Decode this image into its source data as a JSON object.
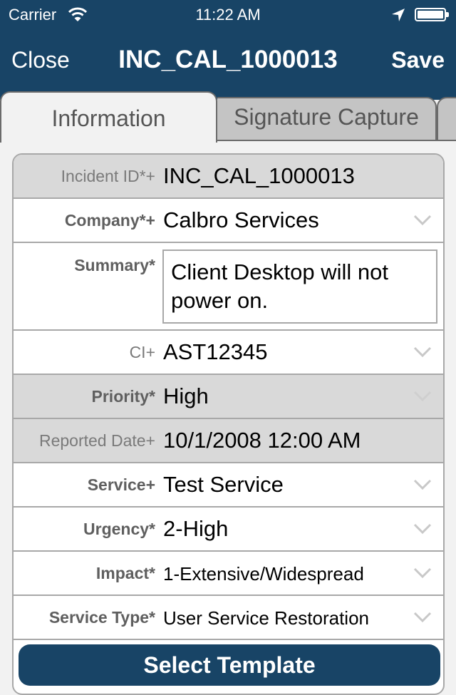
{
  "status_bar": {
    "carrier": "Carrier",
    "time": "11:22 AM",
    "icons": [
      "wifi-icon",
      "location-arrow-icon",
      "battery-icon"
    ]
  },
  "nav": {
    "close_label": "Close",
    "title": "INC_CAL_1000013",
    "save_label": "Save"
  },
  "tabs": [
    {
      "label": "Information",
      "active": true
    },
    {
      "label": "Signature Capture",
      "active": false
    },
    {
      "label": "",
      "active": false
    }
  ],
  "form": {
    "fields": [
      {
        "label": "Incident ID*+",
        "value": "INC_CAL_1000013",
        "readonly": true,
        "dropdown": false
      },
      {
        "label": "Company*+",
        "value": "Calbro Services",
        "readonly": false,
        "dropdown": true
      },
      {
        "label": "Summary*",
        "value": "Client Desktop will not power on.",
        "readonly": false,
        "dropdown": false
      },
      {
        "label": "CI+",
        "value": "AST12345",
        "readonly": false,
        "dropdown": true
      },
      {
        "label": "Priority*",
        "value": "High",
        "readonly": true,
        "dropdown": true
      },
      {
        "label": "Reported Date+",
        "value": "10/1/2008 12:00 AM",
        "readonly": true,
        "dropdown": false
      },
      {
        "label": "Service+",
        "value": "Test Service",
        "readonly": false,
        "dropdown": true
      },
      {
        "label": "Urgency*",
        "value": "2-High",
        "readonly": false,
        "dropdown": true
      },
      {
        "label": "Impact*",
        "value": "1-Extensive/Widespread",
        "readonly": false,
        "dropdown": true
      },
      {
        "label": "Service Type*",
        "value": "User Service Restoration",
        "readonly": false,
        "dropdown": true
      }
    ],
    "template_button_label": "Select Template"
  },
  "colors": {
    "brand": "#184466",
    "readonly_row": "#d9d9d9",
    "border": "#a8a8a8"
  }
}
